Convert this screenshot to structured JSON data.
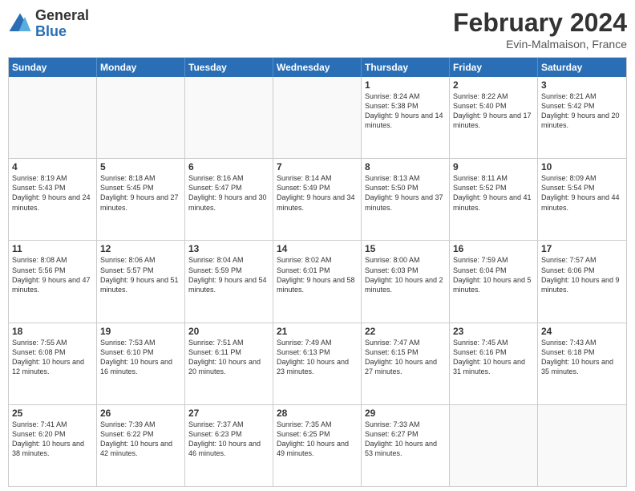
{
  "header": {
    "logo": {
      "general": "General",
      "blue": "Blue"
    },
    "title": "February 2024",
    "location": "Evin-Malmaison, France"
  },
  "days_of_week": [
    "Sunday",
    "Monday",
    "Tuesday",
    "Wednesday",
    "Thursday",
    "Friday",
    "Saturday"
  ],
  "weeks": [
    [
      {
        "day": "",
        "empty": true
      },
      {
        "day": "",
        "empty": true
      },
      {
        "day": "",
        "empty": true
      },
      {
        "day": "",
        "empty": true
      },
      {
        "day": "1",
        "sunrise": "8:24 AM",
        "sunset": "5:38 PM",
        "daylight": "9 hours and 14 minutes."
      },
      {
        "day": "2",
        "sunrise": "8:22 AM",
        "sunset": "5:40 PM",
        "daylight": "9 hours and 17 minutes."
      },
      {
        "day": "3",
        "sunrise": "8:21 AM",
        "sunset": "5:42 PM",
        "daylight": "9 hours and 20 minutes."
      }
    ],
    [
      {
        "day": "4",
        "sunrise": "8:19 AM",
        "sunset": "5:43 PM",
        "daylight": "9 hours and 24 minutes."
      },
      {
        "day": "5",
        "sunrise": "8:18 AM",
        "sunset": "5:45 PM",
        "daylight": "9 hours and 27 minutes."
      },
      {
        "day": "6",
        "sunrise": "8:16 AM",
        "sunset": "5:47 PM",
        "daylight": "9 hours and 30 minutes."
      },
      {
        "day": "7",
        "sunrise": "8:14 AM",
        "sunset": "5:49 PM",
        "daylight": "9 hours and 34 minutes."
      },
      {
        "day": "8",
        "sunrise": "8:13 AM",
        "sunset": "5:50 PM",
        "daylight": "9 hours and 37 minutes."
      },
      {
        "day": "9",
        "sunrise": "8:11 AM",
        "sunset": "5:52 PM",
        "daylight": "9 hours and 41 minutes."
      },
      {
        "day": "10",
        "sunrise": "8:09 AM",
        "sunset": "5:54 PM",
        "daylight": "9 hours and 44 minutes."
      }
    ],
    [
      {
        "day": "11",
        "sunrise": "8:08 AM",
        "sunset": "5:56 PM",
        "daylight": "9 hours and 47 minutes."
      },
      {
        "day": "12",
        "sunrise": "8:06 AM",
        "sunset": "5:57 PM",
        "daylight": "9 hours and 51 minutes."
      },
      {
        "day": "13",
        "sunrise": "8:04 AM",
        "sunset": "5:59 PM",
        "daylight": "9 hours and 54 minutes."
      },
      {
        "day": "14",
        "sunrise": "8:02 AM",
        "sunset": "6:01 PM",
        "daylight": "9 hours and 58 minutes."
      },
      {
        "day": "15",
        "sunrise": "8:00 AM",
        "sunset": "6:03 PM",
        "daylight": "10 hours and 2 minutes."
      },
      {
        "day": "16",
        "sunrise": "7:59 AM",
        "sunset": "6:04 PM",
        "daylight": "10 hours and 5 minutes."
      },
      {
        "day": "17",
        "sunrise": "7:57 AM",
        "sunset": "6:06 PM",
        "daylight": "10 hours and 9 minutes."
      }
    ],
    [
      {
        "day": "18",
        "sunrise": "7:55 AM",
        "sunset": "6:08 PM",
        "daylight": "10 hours and 12 minutes."
      },
      {
        "day": "19",
        "sunrise": "7:53 AM",
        "sunset": "6:10 PM",
        "daylight": "10 hours and 16 minutes."
      },
      {
        "day": "20",
        "sunrise": "7:51 AM",
        "sunset": "6:11 PM",
        "daylight": "10 hours and 20 minutes."
      },
      {
        "day": "21",
        "sunrise": "7:49 AM",
        "sunset": "6:13 PM",
        "daylight": "10 hours and 23 minutes."
      },
      {
        "day": "22",
        "sunrise": "7:47 AM",
        "sunset": "6:15 PM",
        "daylight": "10 hours and 27 minutes."
      },
      {
        "day": "23",
        "sunrise": "7:45 AM",
        "sunset": "6:16 PM",
        "daylight": "10 hours and 31 minutes."
      },
      {
        "day": "24",
        "sunrise": "7:43 AM",
        "sunset": "6:18 PM",
        "daylight": "10 hours and 35 minutes."
      }
    ],
    [
      {
        "day": "25",
        "sunrise": "7:41 AM",
        "sunset": "6:20 PM",
        "daylight": "10 hours and 38 minutes."
      },
      {
        "day": "26",
        "sunrise": "7:39 AM",
        "sunset": "6:22 PM",
        "daylight": "10 hours and 42 minutes."
      },
      {
        "day": "27",
        "sunrise": "7:37 AM",
        "sunset": "6:23 PM",
        "daylight": "10 hours and 46 minutes."
      },
      {
        "day": "28",
        "sunrise": "7:35 AM",
        "sunset": "6:25 PM",
        "daylight": "10 hours and 49 minutes."
      },
      {
        "day": "29",
        "sunrise": "7:33 AM",
        "sunset": "6:27 PM",
        "daylight": "10 hours and 53 minutes."
      },
      {
        "day": "",
        "empty": true
      },
      {
        "day": "",
        "empty": true
      }
    ]
  ]
}
